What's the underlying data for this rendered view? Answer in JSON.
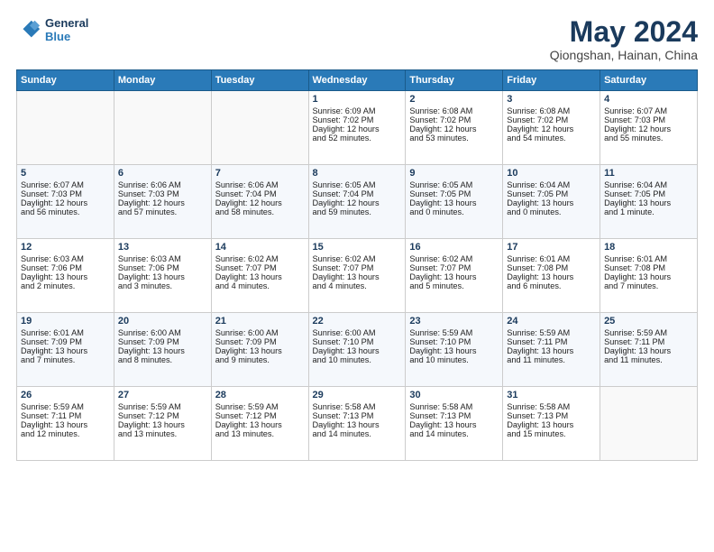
{
  "header": {
    "logo_line1": "General",
    "logo_line2": "Blue",
    "title": "May 2024",
    "subtitle": "Qiongshan, Hainan, China"
  },
  "columns": [
    "Sunday",
    "Monday",
    "Tuesday",
    "Wednesday",
    "Thursday",
    "Friday",
    "Saturday"
  ],
  "weeks": [
    [
      {
        "day": "",
        "text": ""
      },
      {
        "day": "",
        "text": ""
      },
      {
        "day": "",
        "text": ""
      },
      {
        "day": "1",
        "text": "Sunrise: 6:09 AM\nSunset: 7:02 PM\nDaylight: 12 hours\nand 52 minutes."
      },
      {
        "day": "2",
        "text": "Sunrise: 6:08 AM\nSunset: 7:02 PM\nDaylight: 12 hours\nand 53 minutes."
      },
      {
        "day": "3",
        "text": "Sunrise: 6:08 AM\nSunset: 7:02 PM\nDaylight: 12 hours\nand 54 minutes."
      },
      {
        "day": "4",
        "text": "Sunrise: 6:07 AM\nSunset: 7:03 PM\nDaylight: 12 hours\nand 55 minutes."
      }
    ],
    [
      {
        "day": "5",
        "text": "Sunrise: 6:07 AM\nSunset: 7:03 PM\nDaylight: 12 hours\nand 56 minutes."
      },
      {
        "day": "6",
        "text": "Sunrise: 6:06 AM\nSunset: 7:03 PM\nDaylight: 12 hours\nand 57 minutes."
      },
      {
        "day": "7",
        "text": "Sunrise: 6:06 AM\nSunset: 7:04 PM\nDaylight: 12 hours\nand 58 minutes."
      },
      {
        "day": "8",
        "text": "Sunrise: 6:05 AM\nSunset: 7:04 PM\nDaylight: 12 hours\nand 59 minutes."
      },
      {
        "day": "9",
        "text": "Sunrise: 6:05 AM\nSunset: 7:05 PM\nDaylight: 13 hours\nand 0 minutes."
      },
      {
        "day": "10",
        "text": "Sunrise: 6:04 AM\nSunset: 7:05 PM\nDaylight: 13 hours\nand 0 minutes."
      },
      {
        "day": "11",
        "text": "Sunrise: 6:04 AM\nSunset: 7:05 PM\nDaylight: 13 hours\nand 1 minute."
      }
    ],
    [
      {
        "day": "12",
        "text": "Sunrise: 6:03 AM\nSunset: 7:06 PM\nDaylight: 13 hours\nand 2 minutes."
      },
      {
        "day": "13",
        "text": "Sunrise: 6:03 AM\nSunset: 7:06 PM\nDaylight: 13 hours\nand 3 minutes."
      },
      {
        "day": "14",
        "text": "Sunrise: 6:02 AM\nSunset: 7:07 PM\nDaylight: 13 hours\nand 4 minutes."
      },
      {
        "day": "15",
        "text": "Sunrise: 6:02 AM\nSunset: 7:07 PM\nDaylight: 13 hours\nand 4 minutes."
      },
      {
        "day": "16",
        "text": "Sunrise: 6:02 AM\nSunset: 7:07 PM\nDaylight: 13 hours\nand 5 minutes."
      },
      {
        "day": "17",
        "text": "Sunrise: 6:01 AM\nSunset: 7:08 PM\nDaylight: 13 hours\nand 6 minutes."
      },
      {
        "day": "18",
        "text": "Sunrise: 6:01 AM\nSunset: 7:08 PM\nDaylight: 13 hours\nand 7 minutes."
      }
    ],
    [
      {
        "day": "19",
        "text": "Sunrise: 6:01 AM\nSunset: 7:09 PM\nDaylight: 13 hours\nand 7 minutes."
      },
      {
        "day": "20",
        "text": "Sunrise: 6:00 AM\nSunset: 7:09 PM\nDaylight: 13 hours\nand 8 minutes."
      },
      {
        "day": "21",
        "text": "Sunrise: 6:00 AM\nSunset: 7:09 PM\nDaylight: 13 hours\nand 9 minutes."
      },
      {
        "day": "22",
        "text": "Sunrise: 6:00 AM\nSunset: 7:10 PM\nDaylight: 13 hours\nand 10 minutes."
      },
      {
        "day": "23",
        "text": "Sunrise: 5:59 AM\nSunset: 7:10 PM\nDaylight: 13 hours\nand 10 minutes."
      },
      {
        "day": "24",
        "text": "Sunrise: 5:59 AM\nSunset: 7:11 PM\nDaylight: 13 hours\nand 11 minutes."
      },
      {
        "day": "25",
        "text": "Sunrise: 5:59 AM\nSunset: 7:11 PM\nDaylight: 13 hours\nand 11 minutes."
      }
    ],
    [
      {
        "day": "26",
        "text": "Sunrise: 5:59 AM\nSunset: 7:11 PM\nDaylight: 13 hours\nand 12 minutes."
      },
      {
        "day": "27",
        "text": "Sunrise: 5:59 AM\nSunset: 7:12 PM\nDaylight: 13 hours\nand 13 minutes."
      },
      {
        "day": "28",
        "text": "Sunrise: 5:59 AM\nSunset: 7:12 PM\nDaylight: 13 hours\nand 13 minutes."
      },
      {
        "day": "29",
        "text": "Sunrise: 5:58 AM\nSunset: 7:13 PM\nDaylight: 13 hours\nand 14 minutes."
      },
      {
        "day": "30",
        "text": "Sunrise: 5:58 AM\nSunset: 7:13 PM\nDaylight: 13 hours\nand 14 minutes."
      },
      {
        "day": "31",
        "text": "Sunrise: 5:58 AM\nSunset: 7:13 PM\nDaylight: 13 hours\nand 15 minutes."
      },
      {
        "day": "",
        "text": ""
      }
    ]
  ]
}
